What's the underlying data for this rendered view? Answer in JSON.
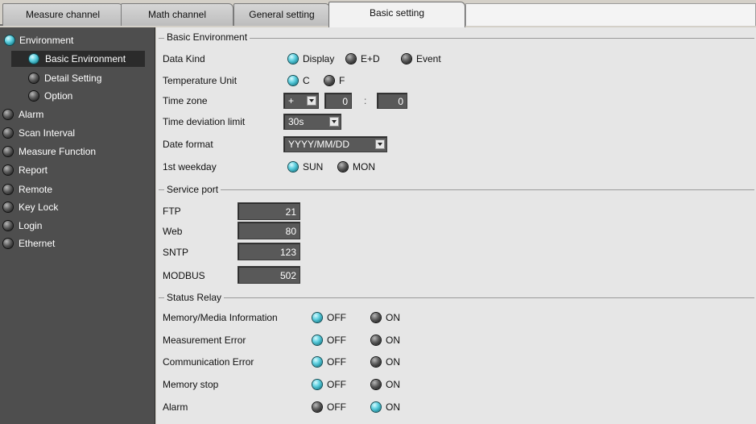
{
  "tabs": [
    {
      "label": "Measure channel"
    },
    {
      "label": "Math channel"
    },
    {
      "label": "General setting"
    },
    {
      "label": "Basic setting",
      "active": true
    }
  ],
  "sidebar": {
    "items": [
      {
        "label": "Environment",
        "state": "on"
      },
      {
        "label": "Basic Environment",
        "state": "on",
        "selected": true
      },
      {
        "label": "Detail Setting",
        "state": "off"
      },
      {
        "label": "Option",
        "state": "off"
      },
      {
        "label": "Alarm",
        "state": "off"
      },
      {
        "label": "Scan Interval",
        "state": "off"
      },
      {
        "label": "Measure Function",
        "state": "off"
      },
      {
        "label": "Report",
        "state": "off"
      },
      {
        "label": "Remote",
        "state": "off"
      },
      {
        "label": "Key Lock",
        "state": "off"
      },
      {
        "label": "Login",
        "state": "off"
      },
      {
        "label": "Ethernet",
        "state": "off"
      }
    ]
  },
  "basic_env": {
    "title": "Basic Environment",
    "data_kind": {
      "label": "Data Kind",
      "options": [
        "Display",
        "E+D",
        "Event"
      ],
      "selected": "Display"
    },
    "temp_unit": {
      "label": "Temperature Unit",
      "options": [
        "C",
        "F"
      ],
      "selected": "C"
    },
    "time_zone": {
      "label": "Time zone",
      "sign": "+",
      "hours": "0",
      "separator": ":",
      "minutes": "0"
    },
    "time_dev": {
      "label": "Time deviation limit",
      "value": "30s"
    },
    "date_format": {
      "label": "Date format",
      "value": "YYYY/MM/DD"
    },
    "weekday": {
      "label": "1st weekday",
      "options": [
        "SUN",
        "MON"
      ],
      "selected": "SUN"
    }
  },
  "service_port": {
    "title": "Service port",
    "ports": [
      {
        "label": "FTP",
        "value": "21"
      },
      {
        "label": "Web",
        "value": "80"
      },
      {
        "label": "SNTP",
        "value": "123"
      },
      {
        "label": "MODBUS",
        "value": "502"
      }
    ]
  },
  "status_relay": {
    "title": "Status Relay",
    "off_label": "OFF",
    "on_label": "ON",
    "rows": [
      {
        "label": "Memory/Media Information",
        "selected": "OFF"
      },
      {
        "label": "Measurement Error",
        "selected": "OFF"
      },
      {
        "label": "Communication Error",
        "selected": "OFF"
      },
      {
        "label": "Memory stop",
        "selected": "OFF"
      },
      {
        "label": "Alarm",
        "selected": "ON"
      }
    ]
  },
  "colors": {
    "accent_on": "#5fd0e0",
    "sidebar_bg": "#4e4e4e",
    "field_bg": "#595959"
  }
}
